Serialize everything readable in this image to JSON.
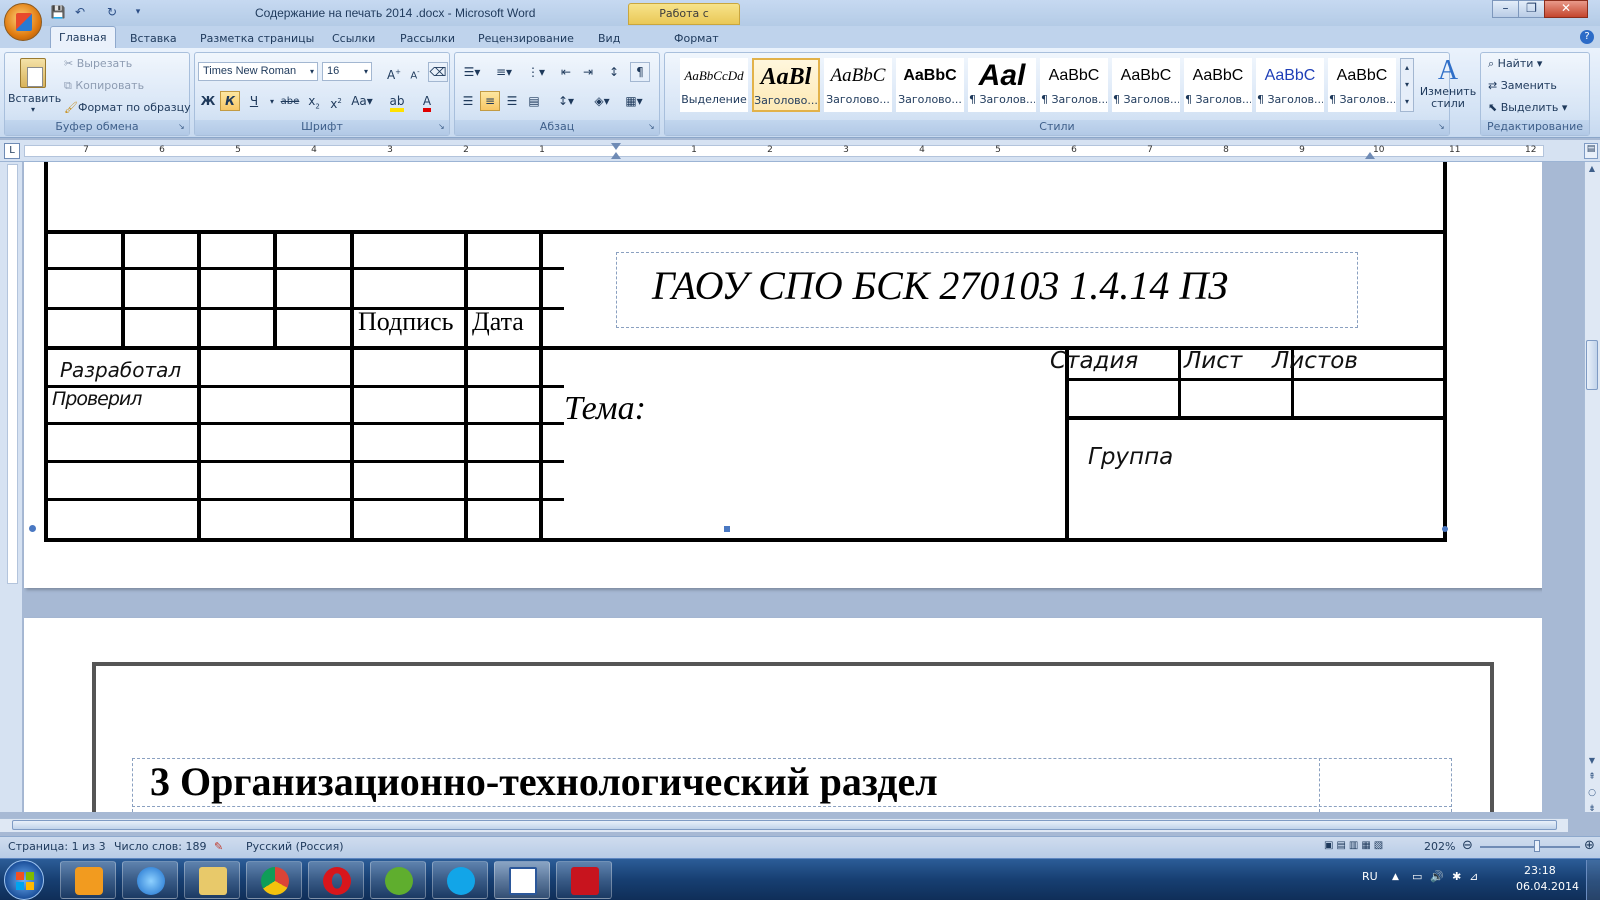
{
  "title_bar": {
    "document_title": "Содержание на печать 2014 .docx - Microsoft Word",
    "context_tab": "Работа с надписями",
    "minimize": "–",
    "restore": "❐",
    "close": "✕"
  },
  "tabs": [
    {
      "label": "Главная",
      "active": true
    },
    {
      "label": "Вставка"
    },
    {
      "label": "Разметка страницы"
    },
    {
      "label": "Ссылки"
    },
    {
      "label": "Рассылки"
    },
    {
      "label": "Рецензирование"
    },
    {
      "label": "Вид"
    },
    {
      "label": "Формат"
    }
  ],
  "ribbon": {
    "clipboard": {
      "label": "Буфер обмена",
      "paste": "Вставить",
      "cut": "Вырезать",
      "copy": "Копировать",
      "format_painter": "Формат по образцу"
    },
    "font": {
      "label": "Шрифт",
      "font_name": "Times New Roman",
      "font_size": "16"
    },
    "paragraph": {
      "label": "Абзац"
    },
    "styles": {
      "label": "Стили",
      "items": [
        {
          "preview": "AaBbCcDd",
          "name": "Выделение"
        },
        {
          "preview": "AaBl",
          "name": "Заголово...",
          "selected": true
        },
        {
          "preview": "AaBbC",
          "name": "Заголово..."
        },
        {
          "preview": "AaBbC",
          "name": "Заголово..."
        },
        {
          "preview": "Aal",
          "name": "¶ Заголов..."
        },
        {
          "preview": "AaBbC",
          "name": "¶ Заголов..."
        },
        {
          "preview": "AaBbC",
          "name": "¶ Заголов..."
        },
        {
          "preview": "AaBbC",
          "name": "¶ Заголов..."
        },
        {
          "preview": "AaBbC",
          "name": "¶ Заголов..."
        },
        {
          "preview": "AaBbC",
          "name": "¶ Заголов..."
        }
      ],
      "change_styles": "Изменить стили"
    },
    "editing": {
      "label": "Редактирование",
      "find": "Найти",
      "replace": "Заменить",
      "select": "Выделить"
    }
  },
  "ruler": {
    "left_numbers": [
      "7",
      "6",
      "5",
      "4",
      "3",
      "2",
      "1"
    ],
    "right_numbers": [
      "1",
      "2",
      "3",
      "4",
      "5",
      "6",
      "7",
      "8",
      "9",
      "10",
      "11",
      "12"
    ]
  },
  "stamp": {
    "signature": "Подпись",
    "date": "Дата",
    "document_code": "ГАОУ СПО БСК  270103 1.4.14  ПЗ",
    "developed": "Разработал",
    "checked": "Проверил",
    "topic": "Тема:",
    "stage": "Стадия",
    "sheet": "Лист",
    "sheets": "Листов",
    "group": "Группа"
  },
  "page2": {
    "heading": "3 Организационно-технологический раздел"
  },
  "status_bar": {
    "page": "Страница: 1 из 3",
    "words": "Число слов: 189",
    "language": "Русский (Россия)",
    "zoom": "202%"
  },
  "taskbar": {
    "lang": "RU",
    "time": "23:18",
    "date": "06.04.2014"
  }
}
